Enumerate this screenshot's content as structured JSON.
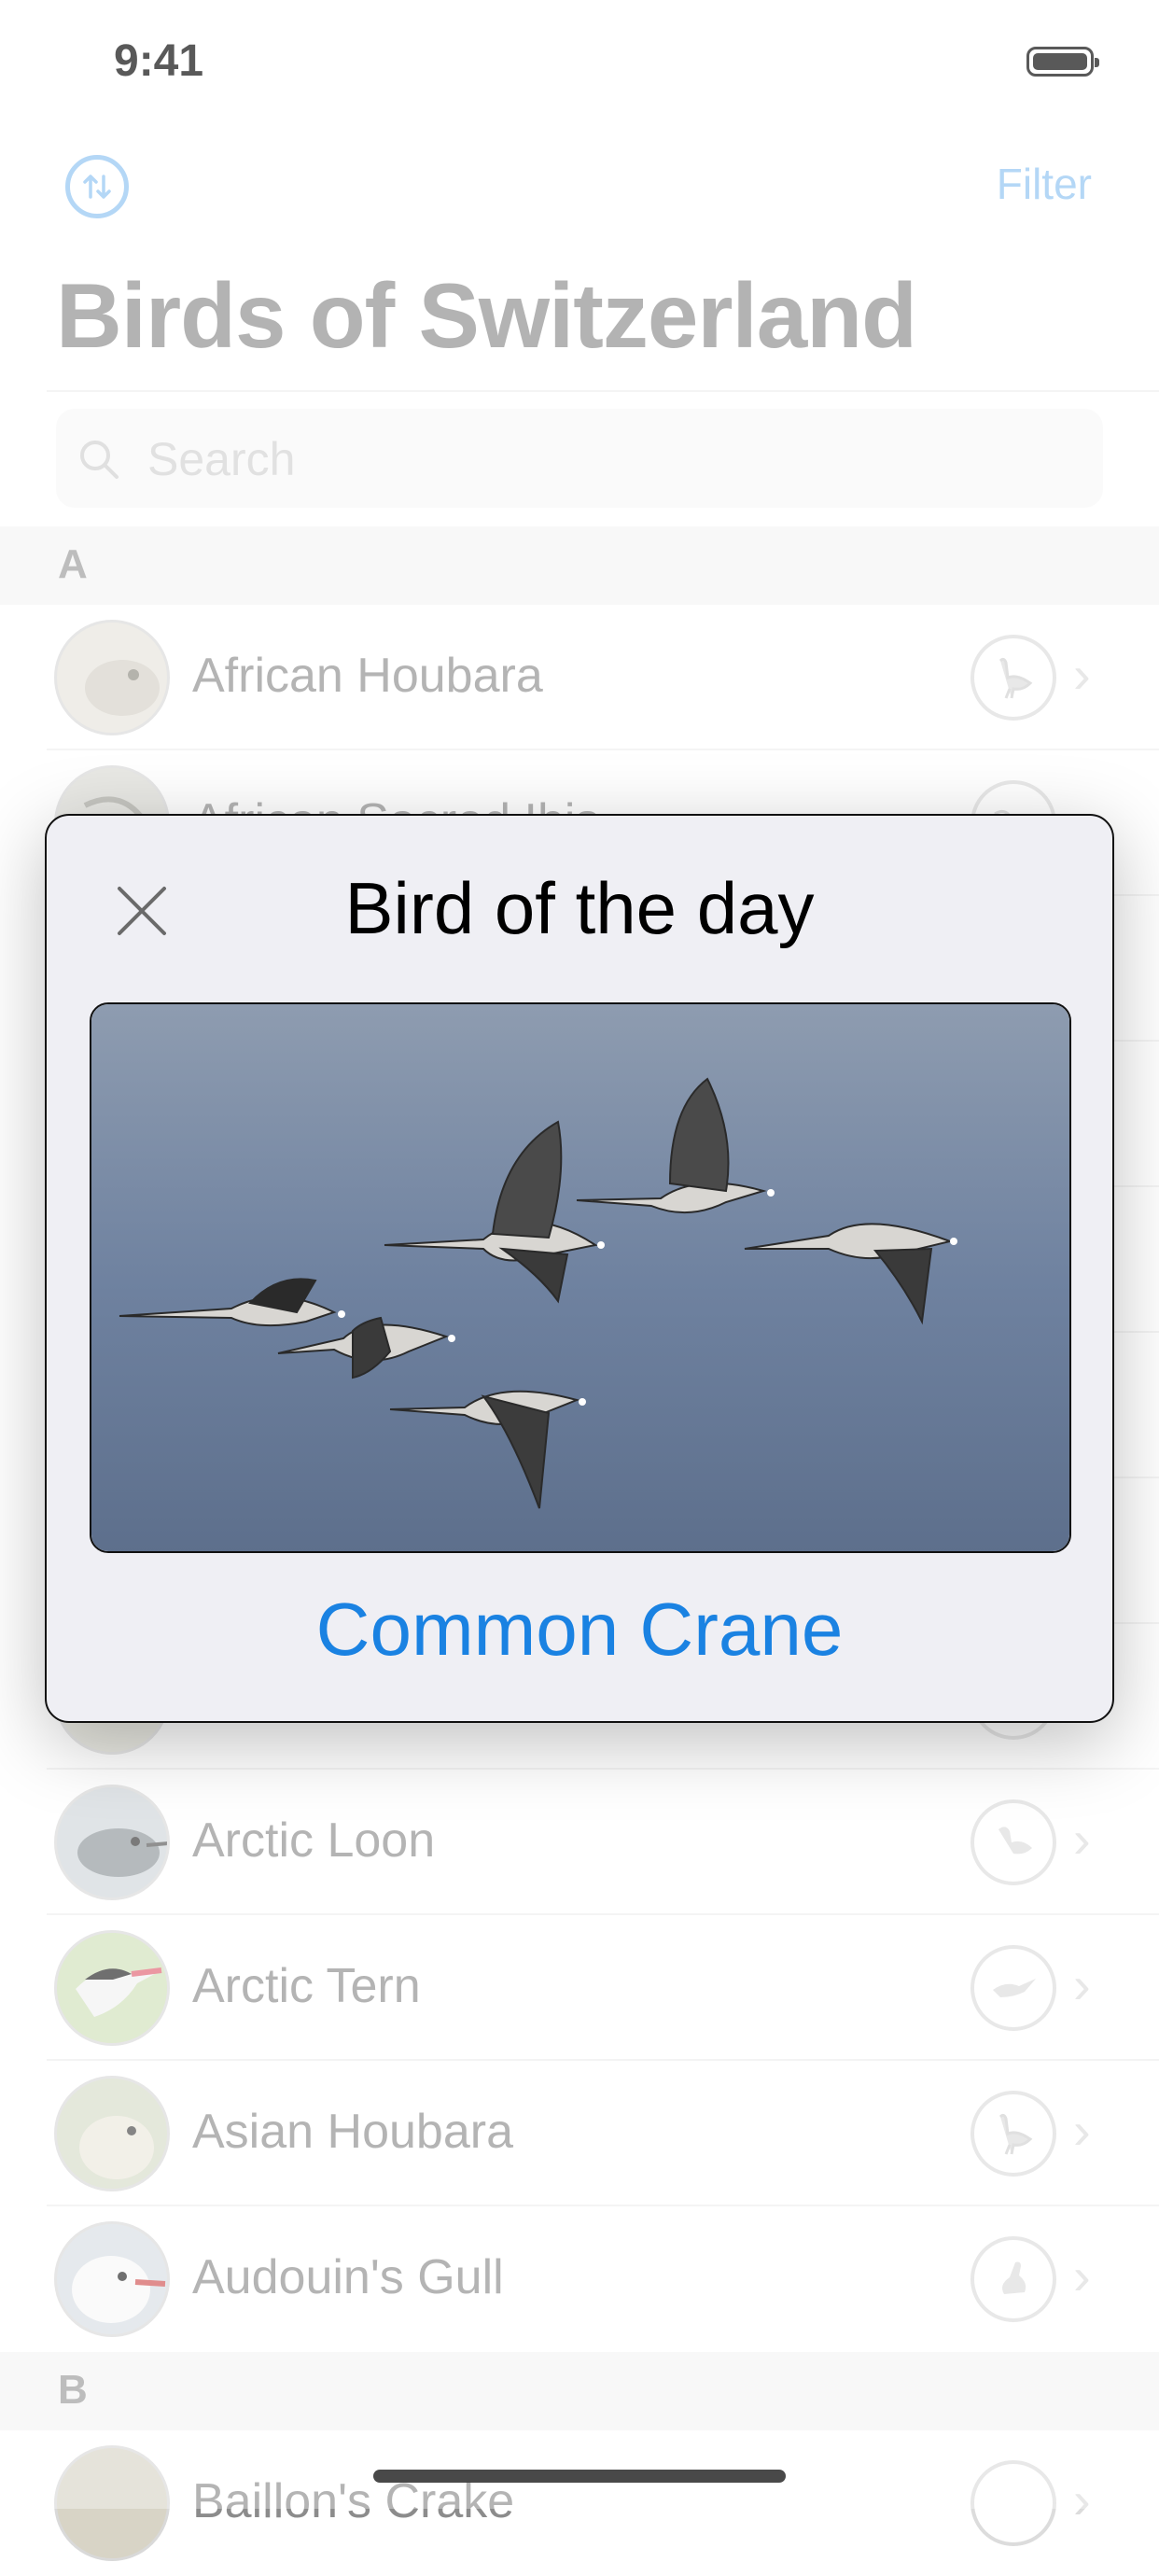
{
  "status_bar": {
    "time": "9:41"
  },
  "nav": {
    "sort_icon": "arrow-up-down-circle-icon",
    "filter_label": "Filter"
  },
  "title": "Birds of Switzerland",
  "search": {
    "placeholder": "Search"
  },
  "sections": [
    {
      "letter": "A"
    },
    {
      "letter": "B"
    }
  ],
  "rows": [
    {
      "name": "African Houbara",
      "bird_type": "bustard"
    },
    {
      "name": "African Sacred Ibis",
      "bird_type": "ibis"
    },
    {
      "name": "Arctic Loon",
      "bird_type": "loon"
    },
    {
      "name": "Arctic Tern",
      "bird_type": "tern"
    },
    {
      "name": "Asian Houbara",
      "bird_type": "bustard"
    },
    {
      "name": "Audouin's Gull",
      "bird_type": "gull"
    },
    {
      "name": "Baillon's Crake",
      "bird_type": "crake"
    }
  ],
  "modal": {
    "title": "Bird of the day",
    "bird_name": "Common Crane",
    "close_icon": "close-icon"
  },
  "colors": {
    "accent": "#1a82e2",
    "muted_accent": "#8cc2f2"
  }
}
